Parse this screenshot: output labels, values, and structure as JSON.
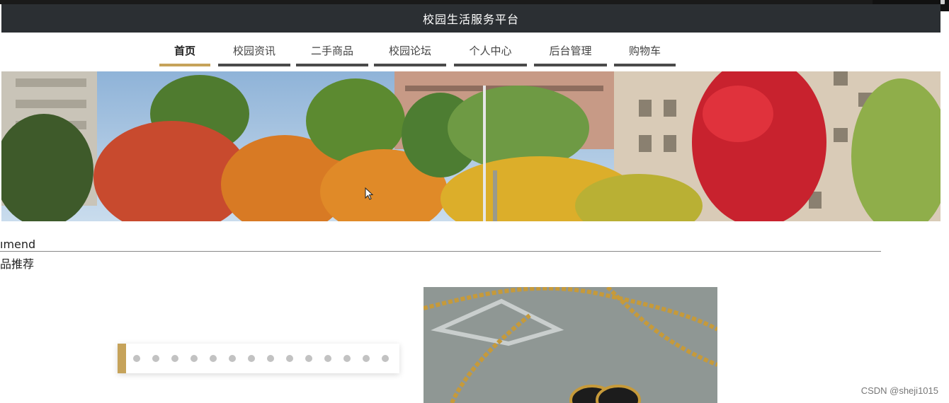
{
  "header": {
    "title": "校园生活服务平台"
  },
  "nav": {
    "items": [
      {
        "label": "首页",
        "active": true
      },
      {
        "label": "校园资讯",
        "active": false
      },
      {
        "label": "二手商品",
        "active": false
      },
      {
        "label": "校园论坛",
        "active": false
      },
      {
        "label": "个人中心",
        "active": false
      },
      {
        "label": "后台管理",
        "active": false
      },
      {
        "label": "购物车",
        "active": false
      }
    ]
  },
  "section": {
    "title_en": "ımend",
    "title_cn": "品推荐"
  },
  "carousel": {
    "dot_count": 14
  },
  "watermark": "CSDN @sheji1015",
  "colors": {
    "header_bg": "#2b2f33",
    "accent": "#c6a35a",
    "nav_bar": "#4a4a4a"
  }
}
